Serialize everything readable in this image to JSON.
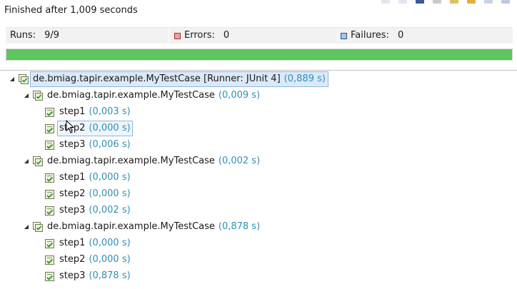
{
  "status": {
    "message": "Finished after 1,009 seconds"
  },
  "counters": {
    "runs_label": "Runs:",
    "runs_value": "9/9",
    "errors_label": "Errors:",
    "errors_value": "0",
    "failures_label": "Failures:",
    "failures_value": "0"
  },
  "progress": {
    "fraction": 1.0,
    "color": "#5ec65e"
  },
  "tree": {
    "root": {
      "label": "de.bmiag.tapir.example.MyTestCase [Runner: JUnit 4]",
      "time": "(0,889 s)"
    },
    "suites": [
      {
        "label": "de.bmiag.tapir.example.MyTestCase",
        "time": "(0,009 s)",
        "steps": [
          {
            "label": "step1",
            "time": "(0,003 s)"
          },
          {
            "label": "step2",
            "time": "(0,000 s)"
          },
          {
            "label": "step3",
            "time": "(0,006 s)"
          }
        ]
      },
      {
        "label": "de.bmiag.tapir.example.MyTestCase",
        "time": "(0,002 s)",
        "steps": [
          {
            "label": "step1",
            "time": "(0,000 s)"
          },
          {
            "label": "step2",
            "time": "(0,000 s)"
          },
          {
            "label": "step3",
            "time": "(0,002 s)"
          }
        ]
      },
      {
        "label": "de.bmiag.tapir.example.MyTestCase",
        "time": "(0,878 s)",
        "steps": [
          {
            "label": "step1",
            "time": "(0,000 s)"
          },
          {
            "label": "step2",
            "time": "(0,000 s)"
          },
          {
            "label": "step3",
            "time": "(0,878 s)"
          }
        ]
      }
    ]
  },
  "colors": {
    "time": "#2f8fb9",
    "success": "#5ec65e",
    "selection": "#8fb8e0"
  }
}
